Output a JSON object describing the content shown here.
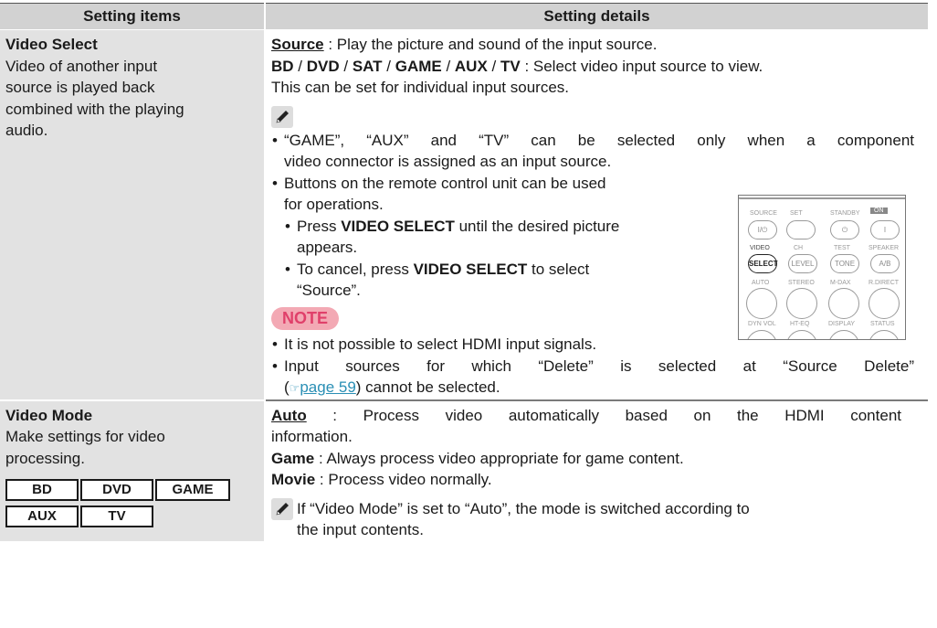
{
  "header": {
    "col1": "Setting items",
    "col2": "Setting details"
  },
  "video_select": {
    "title": "Video Select",
    "desc_line1": "Video of another input",
    "desc_line2": "source is played back",
    "desc_line3": "combined with the playing",
    "desc_line4": "audio.",
    "source_label": "Source",
    "source_text": " : Play the picture and sound of the input source.",
    "bd": "BD",
    "dvd": "DVD",
    "sat": "SAT",
    "game": "GAME",
    "aux": "AUX",
    "tv": "TV",
    "slash": " / ",
    "select_text": " : Select video input source to view.",
    "select_text2": "This can be set for individual input sources.",
    "bullet1_line1": "“GAME”, “AUX” and “TV” can be selected only when a component",
    "bullet1_line2": "video connector is assigned as an input source.",
    "bullet2_line1": "Buttons on the remote control unit can be used",
    "bullet2_line2": "for operations.",
    "sub1_pre": "Press ",
    "sub1_bold": "VIDEO SELECT",
    "sub1_post": " until the desired picture",
    "sub1_line2": "appears.",
    "sub2_pre": "To cancel, press ",
    "sub2_bold": "VIDEO SELECT",
    "sub2_post": " to select",
    "sub2_line2": "“Source”.",
    "note_label": "NOTE",
    "note1": "It is not possible to select HDMI input signals.",
    "note2_line1": "Input sources for which “Delete” is selected at “Source Delete”",
    "note2_open": "(",
    "note2_link": "page 59",
    "note2_post": ") cannot be selected."
  },
  "remote": {
    "source": "SOURCE",
    "set": "SET",
    "standby": "STANDBY",
    "on": "ON",
    "power_sym": "I/⏻",
    "standby_sym": "⏻",
    "on_sym": "I",
    "video": "VIDEO",
    "ch": "CH",
    "test": "TEST",
    "speaker": "SPEAKER",
    "select": "SELECT",
    "level": "LEVEL",
    "tone": "TONE",
    "ab": "A/B",
    "auto": "AUTO",
    "stereo": "STEREO",
    "mdax": "M-DAX",
    "rdirect": "R.DIRECT",
    "dynvol": "DYN VOL",
    "hteq": "HT-EQ",
    "display": "DISPLAY",
    "status": "STATUS"
  },
  "video_mode": {
    "title": "Video Mode",
    "desc_line1": "Make settings for video",
    "desc_line2": "processing.",
    "chips": [
      "BD",
      "DVD",
      "GAME",
      "AUX",
      "TV"
    ],
    "auto_label": "Auto",
    "auto_text": " : Process video automatically based on the HDMI content",
    "auto_text2": "information.",
    "game_label": "Game",
    "game_text": " : Always process video appropriate for game content.",
    "movie_label": "Movie",
    "movie_text": " : Process video normally.",
    "note_line1": "If “Video Mode” is set to “Auto”, the mode is switched according to",
    "note_line2": "the input contents."
  }
}
